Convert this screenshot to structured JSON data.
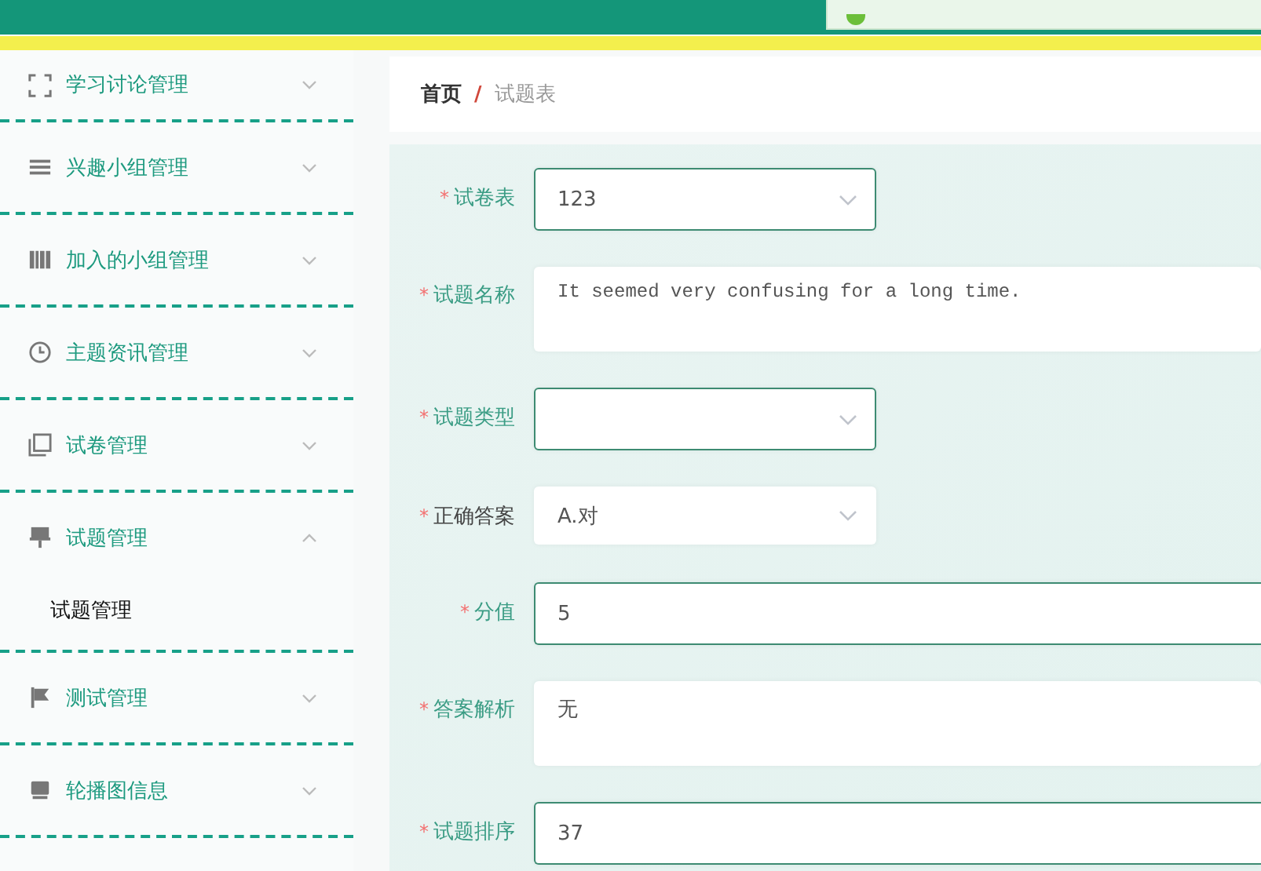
{
  "toast": {
    "kind": "success"
  },
  "sidebar": {
    "items": [
      {
        "label": "学习讨论管理",
        "expanded": false
      },
      {
        "label": "兴趣小组管理",
        "expanded": false
      },
      {
        "label": "加入的小组管理",
        "expanded": false
      },
      {
        "label": "主题资讯管理",
        "expanded": false
      },
      {
        "label": "试卷管理",
        "expanded": false
      },
      {
        "label": "试题管理",
        "expanded": true,
        "children": [
          {
            "label": "试题管理"
          }
        ]
      },
      {
        "label": "测试管理",
        "expanded": false
      },
      {
        "label": "轮播图信息",
        "expanded": false
      }
    ]
  },
  "breadcrumb": {
    "separator": "/",
    "items": [
      {
        "label": "首页"
      },
      {
        "label": "试题表"
      }
    ]
  },
  "form": {
    "fields": [
      {
        "required_mark": "*",
        "label": "试卷表",
        "kind": "select",
        "value": "123",
        "focused": true
      },
      {
        "required_mark": "*",
        "label": "试题名称",
        "kind": "textarea",
        "value": "It seemed very confusing for a long time.",
        "focused": false
      },
      {
        "required_mark": "*",
        "label": "试题类型",
        "kind": "select",
        "focused": true
      },
      {
        "required_mark": "*",
        "label": "正确答案",
        "kind": "select",
        "value": "A.对",
        "focused": false
      },
      {
        "required_mark": "*",
        "label": "分值",
        "kind": "input",
        "value": "5",
        "focused": true
      },
      {
        "required_mark": "*",
        "label": "答案解析",
        "kind": "textarea",
        "value": "无",
        "focused": false
      },
      {
        "required_mark": "*",
        "label": "试题排序",
        "kind": "input",
        "value": "37",
        "focused": true
      }
    ]
  }
}
